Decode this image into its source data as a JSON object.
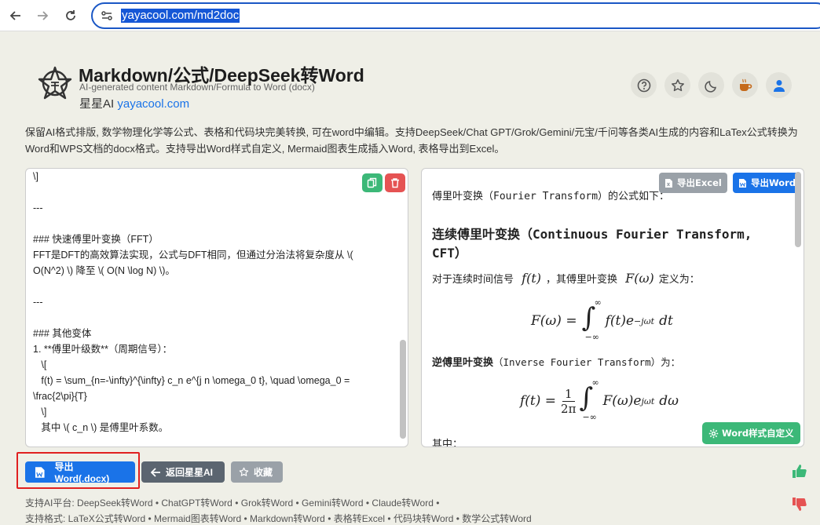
{
  "browser": {
    "url": "yayacool.com/md2doc"
  },
  "header": {
    "title": "Markdown/公式/DeepSeek转Word",
    "subtitle": "AI-generated content Markdown/Formula to Word (docx)",
    "brand_name": "星星AI",
    "brand_link": "yayacool.com"
  },
  "description": "保留AI格式排版, 数学物理化学等公式、表格和代码块完美转换, 可在word中编辑。支持DeepSeek/Chat GPT/Grok/Gemini/元宝/千问等各类AI生成的内容和LaTex公式转换为Word和WPS文档的docx格式。支持导出Word样式自定义, Mermaid图表生成插入Word, 表格导出到Excel。",
  "editor": {
    "lines": [
      "\\]",
      "",
      "---",
      "",
      "### 快速傅里叶变换（FFT）",
      "FFT是DFT的高效算法实现，公式与DFT相同，但通过分治法将复杂度从 \\(",
      "O(N^2) \\) 降至 \\( O(N \\log N) \\)。",
      "",
      "---",
      "",
      "### 其他变体",
      "1. **傅里叶级数**（周期信号）：",
      "   \\[",
      "   f(t) = \\sum_{n=-\\infty}^{\\infty} c_n e^{j n \\omega_0 t}, \\quad \\omega_0 =",
      "\\frac{2\\pi}{T}",
      "   \\]",
      "   其中 \\( c_n \\) 是傅里叶系数。"
    ]
  },
  "preview": {
    "export_excel_label": "导出Excel",
    "export_word_label": "导出Word",
    "intro": "傅里叶变换（Fourier Transform）的公式如下：",
    "heading": "连续傅里叶变换（Continuous Fourier Transform, CFT）",
    "heading_line1": "连续傅里叶变换（Continuous Fourier Transform,",
    "heading_line2": "CFT）",
    "continuous_text_a": "对于连续时间信号",
    "continuous_text_b": "，其傅里叶变换",
    "continuous_text_c": "定义为：",
    "sym_ft": "f(t)",
    "sym_Fw": "F(ω)",
    "formula1_lhs": "F(ω) =",
    "formula1_body": "f(t)e",
    "formula1_exp": "−jωt",
    "formula1_dt": "dt",
    "int_upper": "∞",
    "int_lower": "−∞",
    "inverse_bold": "逆傅里叶变换",
    "inverse_rest": "（Inverse Fourier Transform）为：",
    "formula2_lhs": "f(t) =",
    "formula2_num": "1",
    "formula2_den": "2π",
    "formula2_body": "F(ω)e",
    "formula2_exp": "jωt",
    "formula2_dw": "dω",
    "where": "其中：",
    "word_style_label": "Word样式自定义"
  },
  "actions": {
    "export_word_docx": "导出Word(.docx)",
    "back": "返回星星AI",
    "favorite": "收藏"
  },
  "footer": {
    "platforms_label": "支持AI平台:",
    "platforms": [
      "DeepSeek转Word",
      "ChatGPT转Word",
      "Grok转Word",
      "Gemini转Word",
      "Claude转Word"
    ],
    "formats_label": "支持格式:",
    "formats": [
      "LaTeX公式转Word",
      "Mermaid图表转Word",
      "Markdown转Word",
      "表格转Excel",
      "代码块转Word",
      "数学公式转Word"
    ]
  },
  "colors": {
    "accent": "#1a73e8",
    "danger": "#e55353",
    "success": "#3cb878",
    "gray_btn": "#5b6570"
  }
}
